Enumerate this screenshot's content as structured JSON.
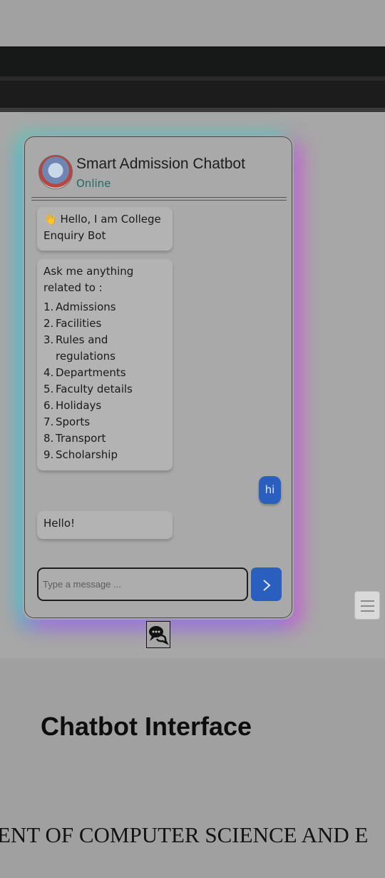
{
  "chat": {
    "title": "Smart Admission Chatbot",
    "status": "Online",
    "messages": {
      "greeting_emoji": "👋",
      "greeting_text": "Hello, I am College Enquiry Bot",
      "ask_intro": "Ask me anything related to :",
      "topics": [
        {
          "num": "1.",
          "label": "Admissions"
        },
        {
          "num": "2.",
          "label": "Facilities"
        },
        {
          "num": "3.",
          "label": "Rules and regulations"
        },
        {
          "num": "4.",
          "label": "Departments"
        },
        {
          "num": "5.",
          "label": "Faculty details"
        },
        {
          "num": "6.",
          "label": "Holidays"
        },
        {
          "num": "7.",
          "label": "Sports"
        },
        {
          "num": "8.",
          "label": "Transport"
        },
        {
          "num": "9.",
          "label": "Scholarship"
        }
      ],
      "user_message": "hi",
      "bot_reply": "Hello!"
    },
    "input": {
      "placeholder": "Type a message ...",
      "value": ""
    },
    "send_icon": "chevron-right-icon",
    "toggle_icon": "chat-bubbles-icon",
    "accent_color": "#2a5fc0"
  },
  "menu_icon": "hamburger-icon",
  "section_heading": "Chatbot Interface",
  "department_text": "ENT OF COMPUTER SCIENCE  AND E"
}
